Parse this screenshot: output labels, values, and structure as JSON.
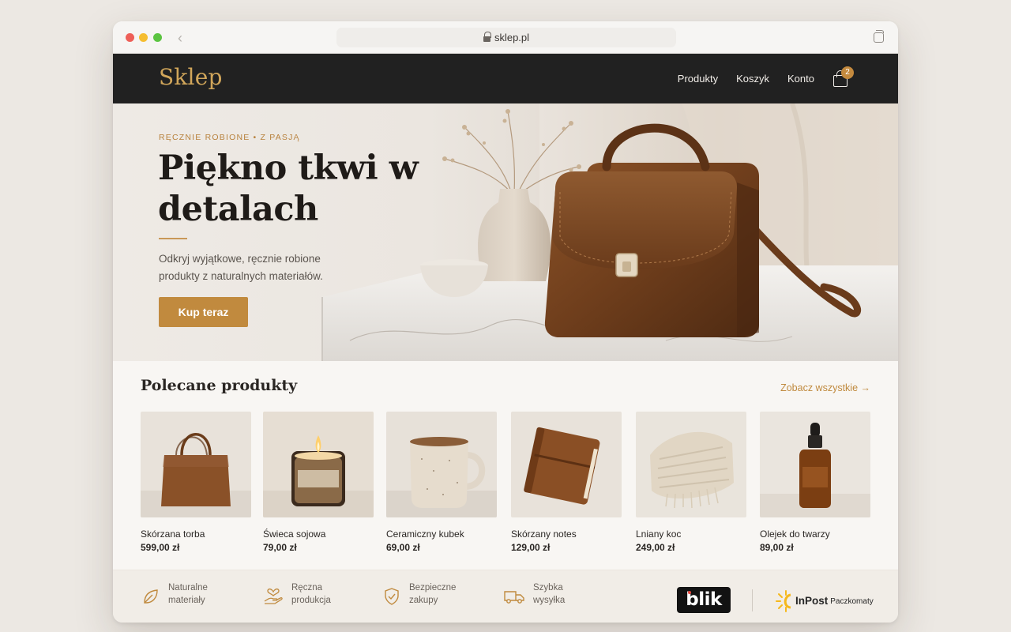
{
  "browser": {
    "url": "sklep.pl"
  },
  "header": {
    "logo": "Sklep",
    "nav": [
      "Produkty",
      "Koszyk",
      "Konto"
    ],
    "cart_count": "2"
  },
  "hero": {
    "eyebrow": "RĘCZNIE ROBIONE • Z PASJĄ",
    "title": "Piękno tkwi w detalach",
    "text": "Odkryj wyjątkowe, ręcznie robione produkty z naturalnych materiałów.",
    "cta": "Kup teraz"
  },
  "featured": {
    "title": "Polecane produkty",
    "see_all": "Zobacz wszystkie →",
    "products": [
      {
        "name": "Skórzana torba",
        "price": "599,00 zł"
      },
      {
        "name": "Świeca sojowa",
        "price": "79,00 zł"
      },
      {
        "name": "Ceramiczny kubek",
        "price": "69,00 zł"
      },
      {
        "name": "Skórzany notes",
        "price": "129,00 zł"
      },
      {
        "name": "Lniany koc",
        "price": "249,00 zł"
      },
      {
        "name": "Olejek do twarzy",
        "price": "89,00 zł"
      }
    ]
  },
  "features": [
    {
      "line1": "Naturalne",
      "line2": "materiały",
      "icon": "leaf-icon"
    },
    {
      "line1": "Ręczna",
      "line2": "produkcja",
      "icon": "hand-heart-icon"
    },
    {
      "line1": "Bezpieczne",
      "line2": "zakupy",
      "icon": "shield-check-icon"
    },
    {
      "line1": "Szybka",
      "line2": "wysyłka",
      "icon": "truck-icon"
    }
  ],
  "payments": {
    "blik": "blik",
    "inpost": "InPost",
    "inpost_sub": "Paczkomaty"
  },
  "colors": {
    "accent": "#c18a3e",
    "header_bg": "#212121",
    "logo": "#d1a65a"
  }
}
